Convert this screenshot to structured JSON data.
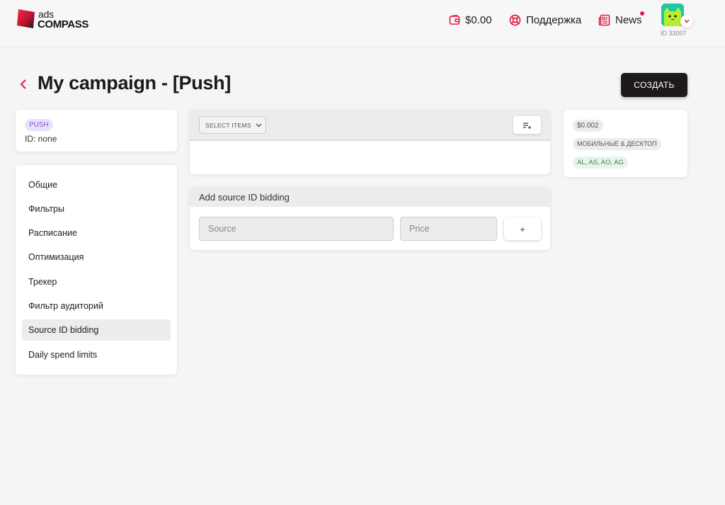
{
  "brand": {
    "ads": "ads",
    "compass": "COMPASS",
    "accent": "#e5193f"
  },
  "header": {
    "balance": "$0.00",
    "support": "Поддержка",
    "news": "News",
    "user_id": "ID 33007"
  },
  "page": {
    "title": "My campaign - [Push]",
    "create_label": "СОЗДАТЬ"
  },
  "campaign": {
    "type_badge": "PUSH",
    "id_text": "ID: none"
  },
  "menu": {
    "items": [
      {
        "label": "Общие"
      },
      {
        "label": "Фильтры"
      },
      {
        "label": "Расписание"
      },
      {
        "label": "Оптимизация"
      },
      {
        "label": "Трекер"
      },
      {
        "label": "Фильтр аудиторий"
      },
      {
        "label": "Source ID bidding",
        "active": true
      },
      {
        "label": "Daily spend limits"
      }
    ]
  },
  "table": {
    "select_label": "SELECT ITEMS"
  },
  "bidding": {
    "title": "Add source ID bidding",
    "source_placeholder": "Source",
    "price_placeholder": "Price",
    "add_label": "+"
  },
  "summary": {
    "price": "$0.002",
    "device": "МОБИЛЬНЫЕ & ДЕСКТОП",
    "geo": "AL, AS, AO, AG"
  }
}
